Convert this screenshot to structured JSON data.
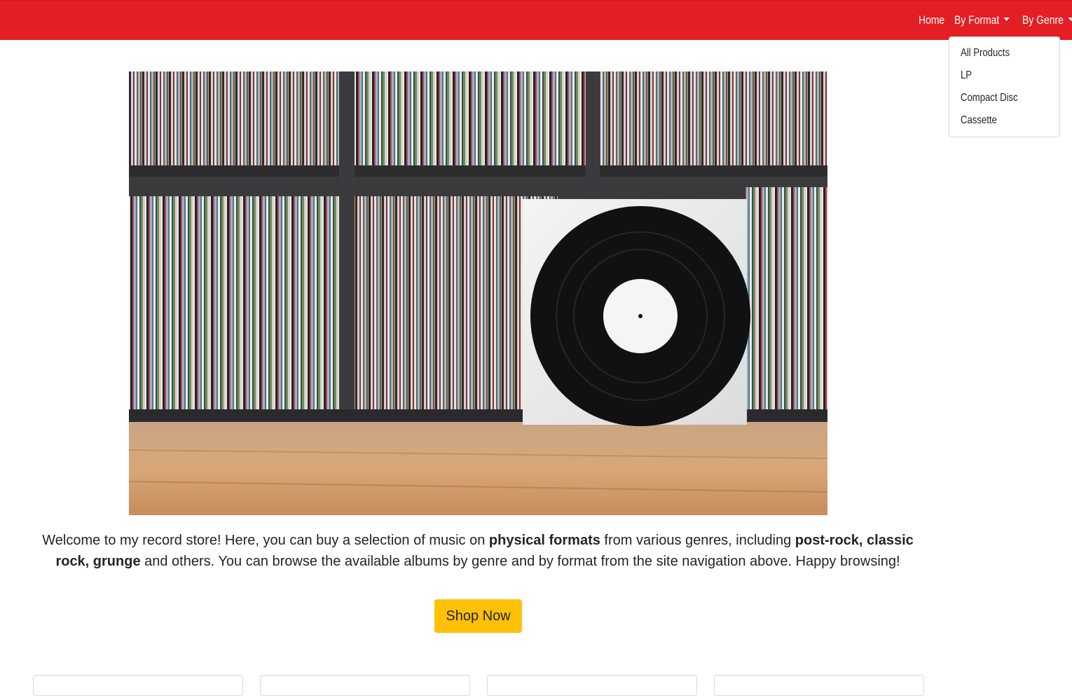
{
  "nav": {
    "home": "Home",
    "by_format": "By Format",
    "by_genre": "By Genre"
  },
  "format_menu": {
    "items": [
      "All Products",
      "LP",
      "Compact Disc",
      "Cassette"
    ]
  },
  "intro": {
    "part1": "Welcome to my record store! Here, you can buy a selection of music on ",
    "bold1": "physical formats",
    "part2": " from various genres, including ",
    "bold2": "post-rock, classic rock, grunge",
    "part3": " and others. You can browse the available albums by genre and by format from the site navigation above. Happy browsing!"
  },
  "cta": {
    "label": "Shop Now"
  },
  "colors": {
    "navbar": "#e31e24",
    "button": "#ffc107"
  }
}
